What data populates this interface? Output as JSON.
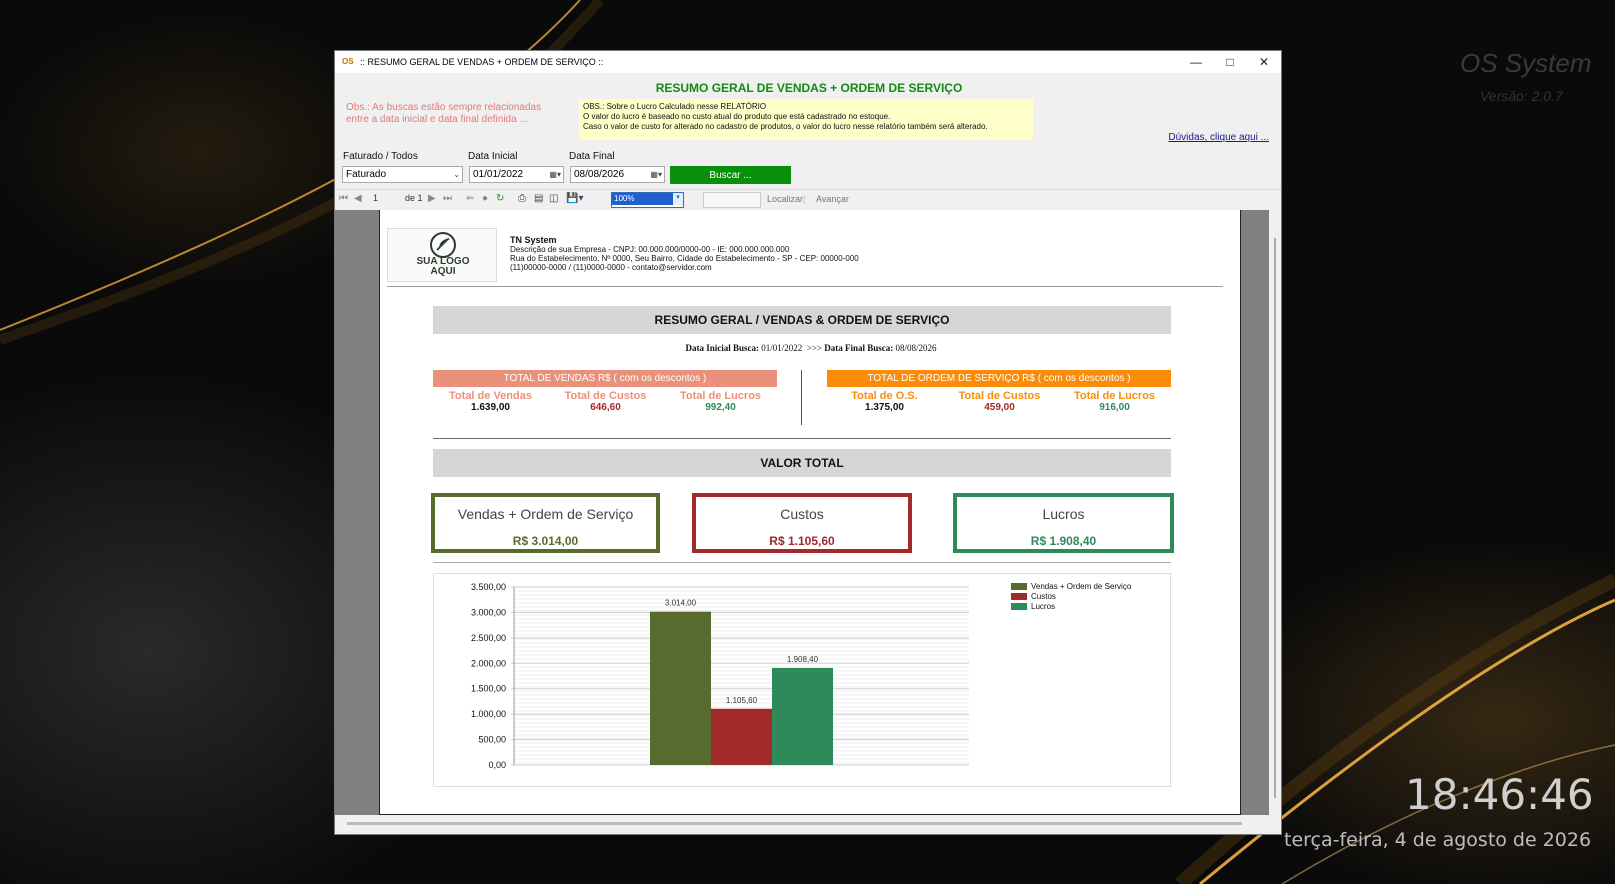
{
  "desktop": {
    "brand": "OS System",
    "version": "Versão: 2.0.7",
    "clock": "18:46:46",
    "date": "terça-feira, 4 de agosto de 2026"
  },
  "window": {
    "title": ":: RESUMO GERAL DE VENDAS + ORDEM DE SERVIÇO ::",
    "header": "RESUMO GERAL DE VENDAS + ORDEM DE SERVIÇO",
    "obs_left": "Obs.: As buscas estão sempre relacionadas entre a data inicial e data final definida ...",
    "obs_box": {
      "line1": "OBS.: Sobre o Lucro Calculado nesse RELATÓRIO",
      "line2": "O valor do lucro é baseado no custo atual do produto que está cadastrado no estoque.",
      "line3": "Caso o valor de custo for alterado no cadastro de produtos, o valor do lucro nesse relatório também será alterado."
    },
    "help_link": "Dúvidas, clique aqui ...",
    "filters": {
      "status_label": "Faturado / Todos",
      "status_value": "Faturado",
      "start_label": "Data Inicial",
      "start_value": "01/01/2022",
      "end_label": "Data Final",
      "end_value": "08/08/2026",
      "search_button": "Buscar ..."
    },
    "toolbar": {
      "page": "1",
      "of": "de 1",
      "zoom": "100%",
      "find": "Localizar",
      "next": "Avançar"
    }
  },
  "report": {
    "logo": {
      "line1": "SUA LOGO",
      "line2": "AQUI"
    },
    "company": {
      "name": "TN System",
      "desc": "Descrição de sua Empresa - CNPJ: 00.000.000/0000-00 - IE: 000.000.000.000",
      "address": "Rua do Estabelecimento, Nº 0000, Seu Bairro, Cidade do Estabelecimento - SP - CEP: 00000-000",
      "contact": "(11)00000-0000 / (11)0000-0000 - contato@servidor.com"
    },
    "title": "RESUMO GERAL / VENDAS & ORDEM DE SERVIÇO",
    "dates": {
      "start_label": "Data Inicial Busca:",
      "start": "01/01/2022",
      "arrows": ">>>",
      "end_label": "Data Final Busca:",
      "end": "08/08/2026"
    },
    "vendas": {
      "header": "TOTAL DE VENDAS R$ ( com os descontos )",
      "total_label": "Total de Vendas",
      "total": "1.639,00",
      "custos_label": "Total de Custos",
      "custos": "646,60",
      "lucros_label": "Total de Lucros",
      "lucros": "992,40"
    },
    "os": {
      "header": "TOTAL DE ORDEM DE SERVIÇO R$ ( com os descontos )",
      "total_label": "Total de O.S.",
      "total": "1.375,00",
      "custos_label": "Total de Custos",
      "custos": "459,00",
      "lucros_label": "Total de Lucros",
      "lucros": "916,00"
    },
    "valor_total": "VALOR TOTAL",
    "boxes": {
      "vendas_os_label": "Vendas + Ordem de Serviço",
      "vendas_os_value": "R$ 3.014,00",
      "custos_label": "Custos",
      "custos_value": "R$ 1.105,60",
      "lucros_label": "Lucros",
      "lucros_value": "R$ 1.908,40"
    },
    "colors": {
      "vendas_header": "#e9917a",
      "os_header": "#fb8c0a",
      "olive": "#586b2f",
      "red": "#a32a2a",
      "green": "#2e8a5a"
    }
  },
  "chart_data": {
    "type": "bar",
    "categories": [
      "Vendas + Ordem de Serviço",
      "Custos",
      "Lucros"
    ],
    "values": [
      3014.0,
      1105.6,
      1908.4
    ],
    "value_labels": [
      "3.014,00",
      "1.105,60",
      "1.908,40"
    ],
    "colors": [
      "#586b2f",
      "#a32a2a",
      "#2e8a5a"
    ],
    "ylim": [
      0,
      3500
    ],
    "yticks": [
      0,
      500,
      1000,
      1500,
      2000,
      2500,
      3000,
      3500
    ],
    "ytick_labels": [
      "0,00",
      "500,00",
      "1.000,00",
      "1.500,00",
      "2.000,00",
      "2.500,00",
      "3.000,00",
      "3.500,00"
    ],
    "legend_position": "top-right",
    "grid": true
  }
}
